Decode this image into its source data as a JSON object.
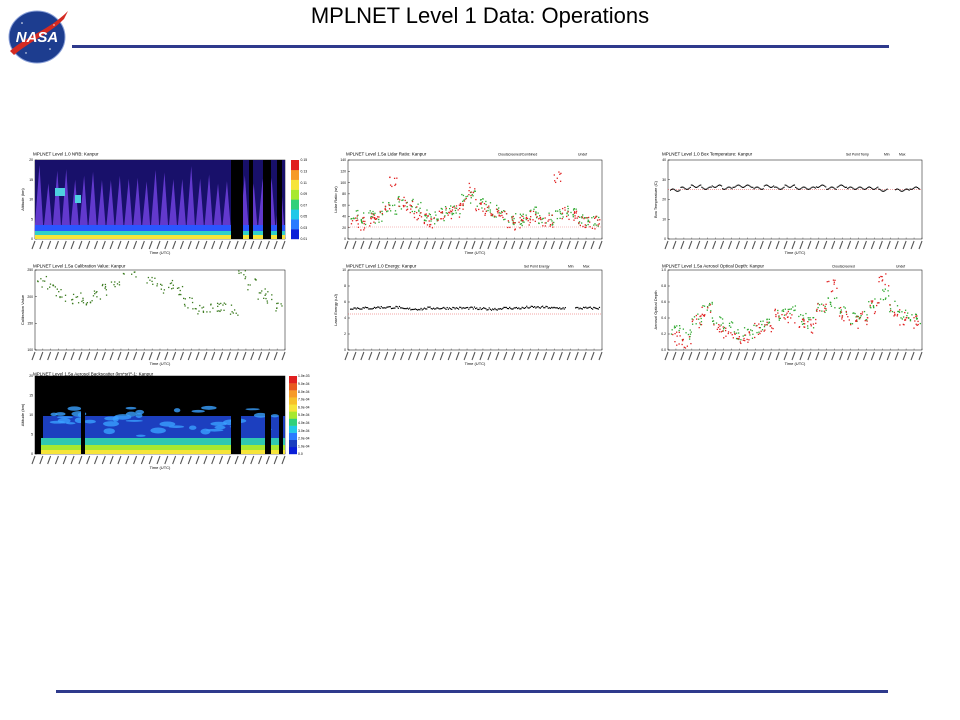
{
  "slide": {
    "title": "MPLNET Level 1 Data:  Operations",
    "logo_text": "NASA",
    "rule_color": "#2e3a8c"
  },
  "panels": {
    "nrb": {
      "title": "MPLNET Level 1.0 NRB: Kanpur",
      "ylabel": "Altitude (km)",
      "xlabel": "Time (UTC)",
      "yticks": [
        "0",
        "5",
        "10",
        "15",
        "20"
      ],
      "colorbar_ticks": [
        "0.01",
        "0.03",
        "0.05",
        "0.07",
        "0.09",
        "0.11",
        "0.13",
        "0.15"
      ]
    },
    "snr": {
      "title": "MPLNET Level 1.5a Lidar Ratio: Kanpur",
      "legend": [
        "Cloudscreened/Combined",
        "Undef"
      ],
      "ylabel": "Lidar Ratio (sr)",
      "xlabel": "Time (UTC)",
      "yticks": [
        "0",
        "20",
        "40",
        "60",
        "80",
        "100",
        "120",
        "140"
      ]
    },
    "box": {
      "title": "MPLNET Level 1.0 Box Temperature: Kanpur",
      "legend": [
        "Set Point Temp",
        "Min",
        "Max"
      ],
      "ylabel": "Box Temperature (C)",
      "xlabel": "Time (UTC)",
      "yticks": [
        "0",
        "10",
        "20",
        "30",
        "40"
      ]
    },
    "cal": {
      "title": "MPLNET Level 1.5a Calibration Value: Kanpur",
      "ylabel": "Calibration Value",
      "xlabel": "Time (UTC)",
      "yticks": [
        "100",
        "150",
        "200",
        "250"
      ]
    },
    "energy": {
      "title": "MPLNET Level 1.0 Energy: Kanpur",
      "legend": [
        "Set Point Energy",
        "Min",
        "Max"
      ],
      "ylabel": "Laser Energy (uJ)",
      "xlabel": "Time (UTC)",
      "yticks": [
        "0",
        "2",
        "4",
        "6",
        "8",
        "10"
      ]
    },
    "aod": {
      "title": "MPLNET Level 1.5a Aerosol Optical Depth: Kanpur",
      "legend": [
        "Cloudscreened",
        "Undef"
      ],
      "ylabel": "Aerosol Optical Depth",
      "xlabel": "Time (UTC)",
      "yticks": [
        "0.0",
        "0.2",
        "0.4",
        "0.6",
        "0.8",
        "1.0"
      ]
    },
    "backscatter": {
      "title": "MPLNET Level 1.5a Aerosol Backscatter (km*sr)^-1: Kanpur",
      "ylabel": "Altitude (km)",
      "xlabel": "Time (UTC)",
      "yticks": [
        "0",
        "5",
        "10",
        "15",
        "20"
      ],
      "colorbar_ticks": [
        "1.0e-03",
        "9.0e-04",
        "8.0e-04",
        "7.0e-04",
        "6.0e-04",
        "5.0e-04",
        "4.0e-04",
        "3.0e-04",
        "2.0e-04",
        "1.0e-04",
        "0.0"
      ]
    }
  },
  "colors": {
    "green": "#2ea82e",
    "red": "#e02020",
    "black": "#000000",
    "cal_green": "#3a7a1e"
  },
  "chart_data": [
    {
      "type": "heatmap",
      "title": "MPLNET Level 1.0 NRB: Kanpur",
      "ylabel": "Altitude (km)",
      "xlabel": "Time (UTC)",
      "ylim": [
        0,
        20
      ]
    },
    {
      "type": "scatter",
      "title": "MPLNET Level 1.5a Lidar Ratio: Kanpur",
      "ylabel": "Lidar Ratio (sr)",
      "xlabel": "Time (UTC)",
      "ylim": [
        0,
        150
      ],
      "series": [
        {
          "name": "Cloudscreened/Combined",
          "values": [
            45,
            40,
            50,
            42,
            60,
            55,
            70,
            65,
            58,
            45,
            42,
            48,
            52,
            60,
            75,
            80,
            70,
            62,
            55,
            48,
            40,
            38,
            45,
            50,
            42,
            40,
            45,
            55,
            50,
            40,
            38,
            35
          ]
        },
        {
          "name": "Undef",
          "values": [
            35,
            30,
            38,
            45,
            55,
            110,
            75,
            60,
            50,
            40,
            35,
            42,
            48,
            55,
            70,
            95,
            65,
            58,
            50,
            45,
            35,
            30,
            40,
            45,
            38,
            35,
            120,
            50,
            45,
            35,
            30,
            32
          ]
        }
      ]
    },
    {
      "type": "line",
      "title": "MPLNET Level 1.0 Box Temperature: Kanpur",
      "ylabel": "Box Temperature (C)",
      "xlabel": "Time (UTC)",
      "ylim": [
        0,
        40
      ],
      "series": [
        {
          "name": "Set Point Temp",
          "values": [
            25,
            25,
            25,
            25,
            25,
            25,
            25,
            25,
            25,
            25,
            25,
            25,
            25,
            25,
            25,
            25,
            25,
            25,
            25,
            25,
            25,
            25,
            25,
            25
          ]
        },
        {
          "name": "Box Temperature",
          "values": [
            25,
            26,
            27,
            26,
            27,
            26,
            27,
            27,
            26,
            27,
            26,
            27,
            26,
            26,
            27,
            26,
            27,
            26,
            26,
            26,
            25,
            25,
            25,
            26
          ]
        }
      ]
    },
    {
      "type": "scatter",
      "title": "MPLNET Level 1.5a Calibration Value: Kanpur",
      "ylabel": "Calibration Value",
      "xlabel": "Time (UTC)",
      "ylim": [
        100,
        280
      ],
      "series": [
        {
          "name": "Calibration Value",
          "values": [
            230,
            215,
            210,
            195,
            200,
            190,
            205,
            215,
            230,
            250,
            245,
            260,
            235,
            215,
            225,
            210,
            190,
            180,
            175,
            185,
            180,
            175,
            240,
            225,
            205,
            200,
            185
          ]
        }
      ]
    },
    {
      "type": "scatter",
      "title": "MPLNET Level 1.0 Energy: Kanpur",
      "ylabel": "Laser Energy (uJ)",
      "xlabel": "Time (UTC)",
      "ylim": [
        0,
        10
      ],
      "series": [
        {
          "name": "Set Point Energy",
          "values": [
            4.5,
            4.5,
            4.5,
            4.5,
            4.5,
            4.5,
            4.5,
            4.5,
            4.5,
            4.5
          ]
        },
        {
          "name": "Energy",
          "values": [
            5.3,
            5.4,
            5.2,
            5.3,
            5.3,
            5.2,
            5.3,
            5.4,
            5.3,
            5.3
          ]
        }
      ]
    },
    {
      "type": "scatter",
      "title": "MPLNET Level 1.5a Aerosol Optical Depth: Kanpur",
      "ylabel": "Aerosol Optical Depth",
      "xlabel": "Time (UTC)",
      "ylim": [
        0,
        1.0
      ],
      "series": [
        {
          "name": "Cloudscreened",
          "values": [
            0.25,
            0.2,
            0.4,
            0.55,
            0.35,
            0.3,
            0.2,
            0.22,
            0.3,
            0.35,
            0.45,
            0.5,
            0.4,
            0.35,
            0.55,
            0.6,
            0.5,
            0.4,
            0.45,
            0.6,
            0.7,
            0.55,
            0.45,
            0.4
          ]
        },
        {
          "name": "Undef",
          "values": [
            0.15,
            0.1,
            0.35,
            0.5,
            0.3,
            0.25,
            0.15,
            0.18,
            0.25,
            0.3,
            0.45,
            0.4,
            0.35,
            0.3,
            0.5,
            0.8,
            0.45,
            0.35,
            0.4,
            0.55,
            0.9,
            0.5,
            0.4,
            0.35
          ]
        }
      ]
    },
    {
      "type": "heatmap",
      "title": "MPLNET Level 1.5a Aerosol Backscatter (km*sr)^-1: Kanpur",
      "ylabel": "Altitude (km)",
      "xlabel": "Time (UTC)",
      "ylim": [
        0,
        20
      ]
    }
  ]
}
